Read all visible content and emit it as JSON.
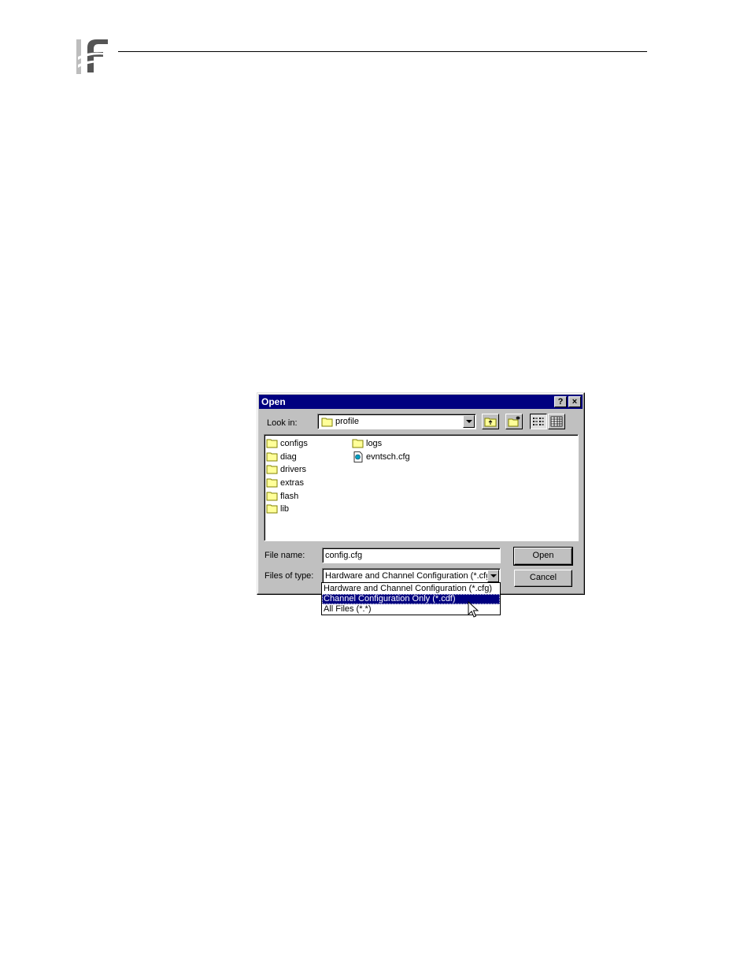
{
  "dialog": {
    "title": "Open",
    "help_button": "?",
    "close_button": "×",
    "look_in_label": "Look in:",
    "look_in_value": "profile",
    "file_name_label": "File name:",
    "file_name_value": "config.cfg",
    "files_of_type_label": "Files of type:",
    "files_of_type_value": "Hardware and Channel Configuration (*.cfg)",
    "open_button": "Open",
    "cancel_button": "Cancel",
    "items": [
      {
        "name": "configs",
        "type": "folder"
      },
      {
        "name": "diag",
        "type": "folder"
      },
      {
        "name": "drivers",
        "type": "folder"
      },
      {
        "name": "extras",
        "type": "folder"
      },
      {
        "name": "flash",
        "type": "folder"
      },
      {
        "name": "lib",
        "type": "folder"
      },
      {
        "name": "logs",
        "type": "folder"
      },
      {
        "name": "evntsch.cfg",
        "type": "file"
      }
    ],
    "type_options": [
      {
        "label": "Hardware and Channel Configuration (*.cfg)",
        "selected": false
      },
      {
        "label": "Channel Configuration Only (*.cdf)",
        "selected": true
      },
      {
        "label": "All Files (*.*)",
        "selected": false
      }
    ]
  }
}
